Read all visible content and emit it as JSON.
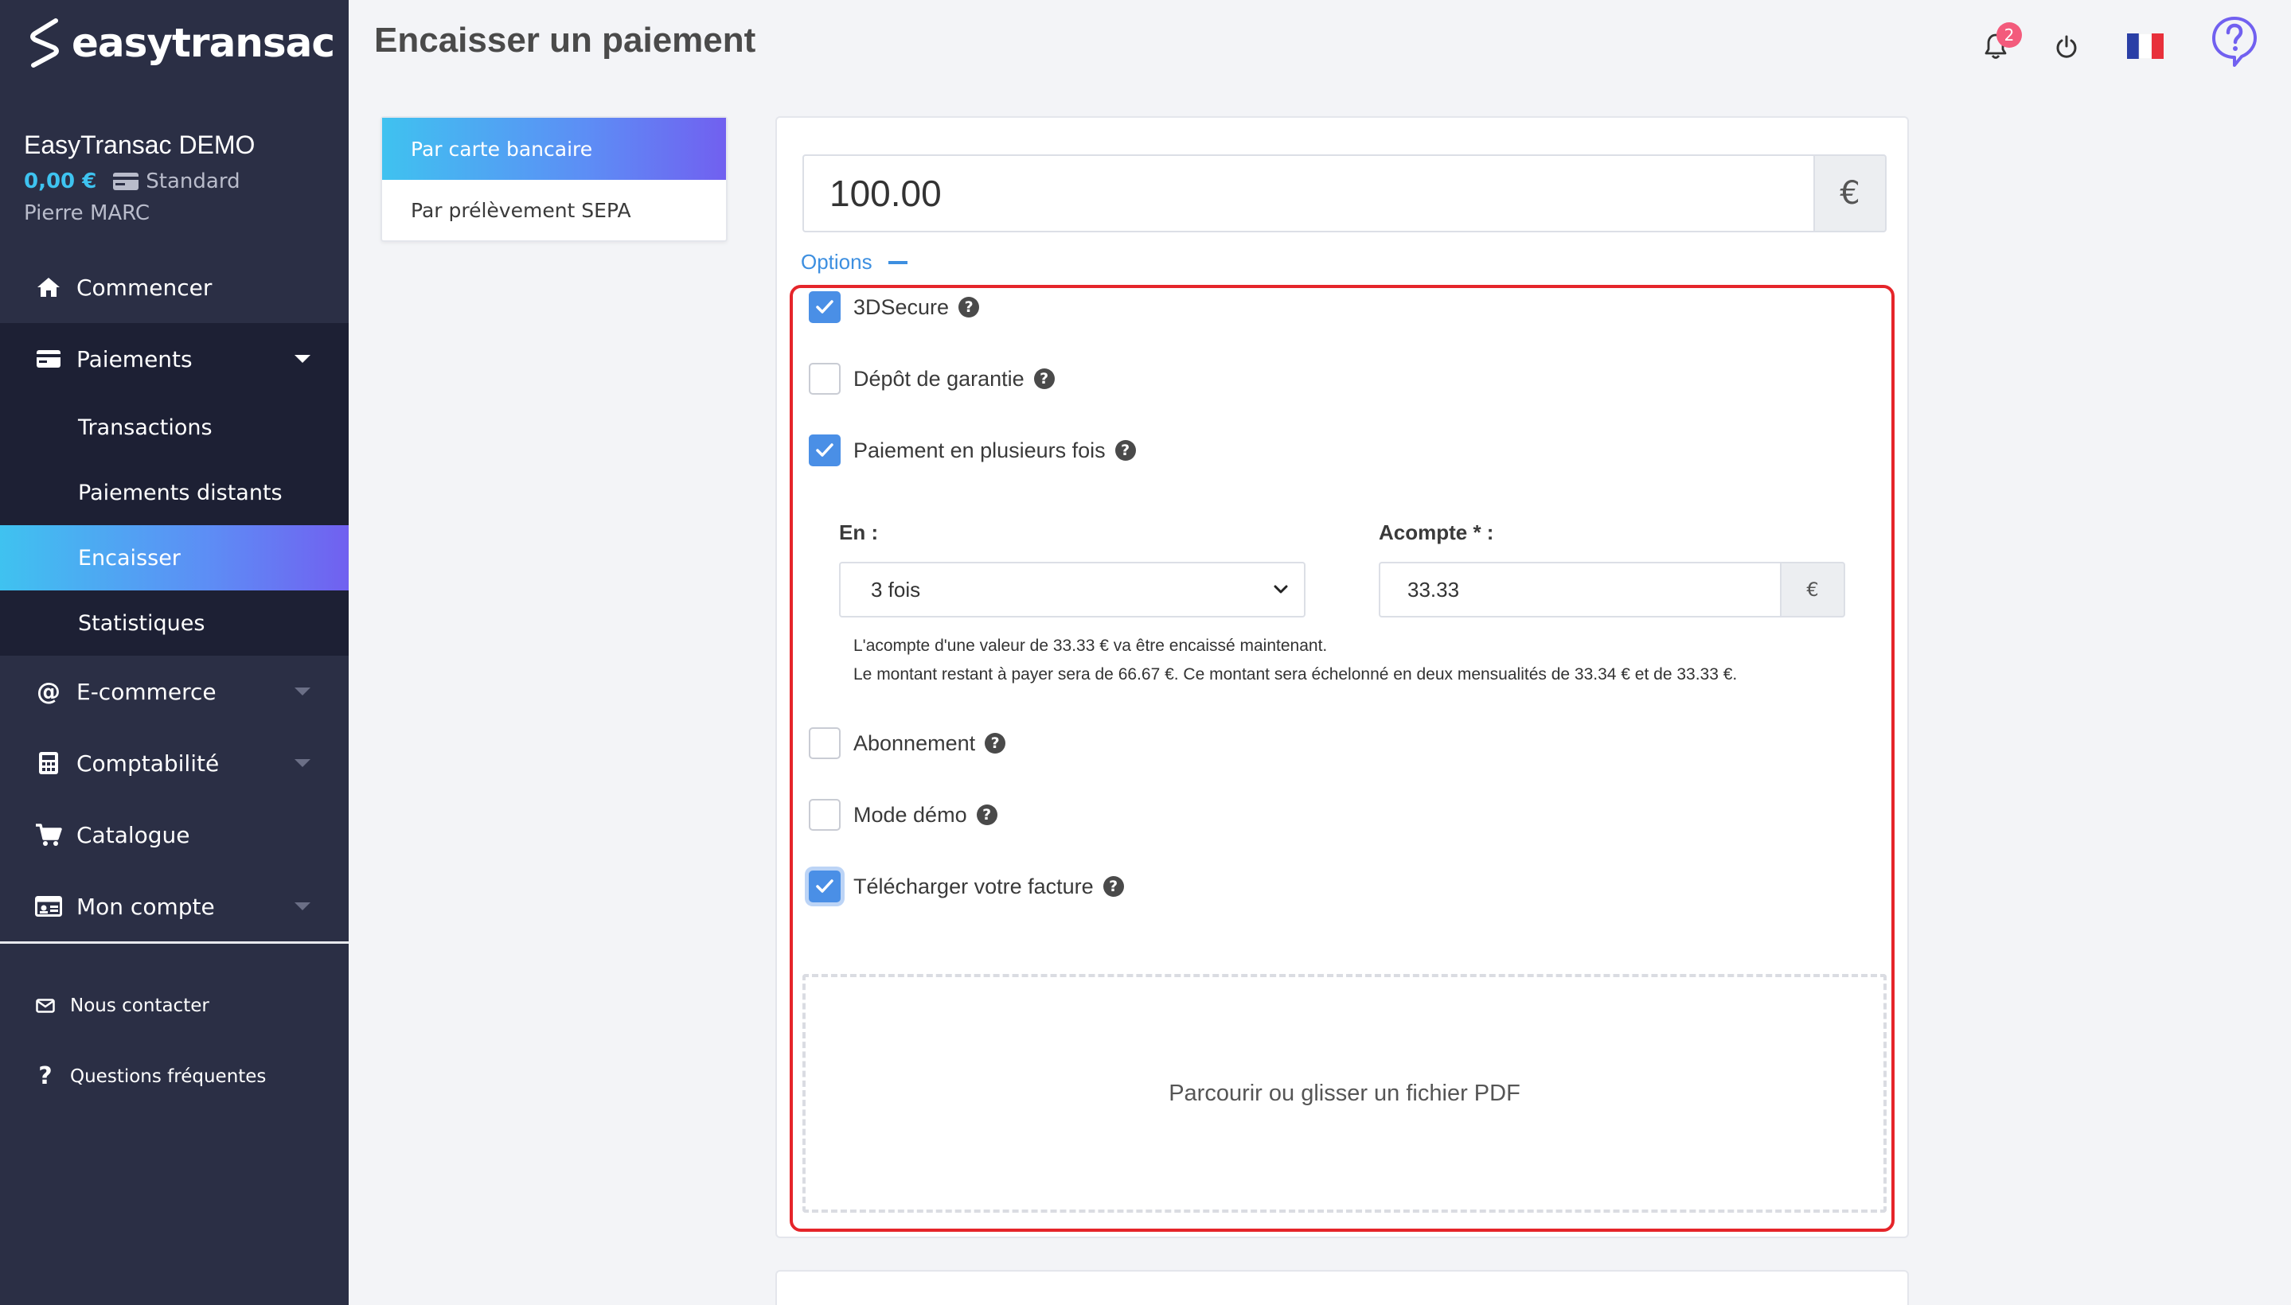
{
  "app": {
    "logo_text": "easytransac"
  },
  "account": {
    "name": "EasyTransac DEMO",
    "balance": "0,00 €",
    "plan": "Standard",
    "user": "Pierre MARC"
  },
  "sidebar": {
    "items": [
      {
        "label": "Commencer",
        "icon": "home-icon"
      },
      {
        "label": "Paiements",
        "icon": "credit-card-icon"
      },
      {
        "label": "E-commerce",
        "icon": "at-icon"
      },
      {
        "label": "Comptabilité",
        "icon": "calculator-icon"
      },
      {
        "label": "Catalogue",
        "icon": "cart-icon"
      },
      {
        "label": "Mon compte",
        "icon": "id-card-icon"
      }
    ],
    "payments_sub": [
      "Transactions",
      "Paiements distants",
      "Encaisser",
      "Statistiques"
    ],
    "footer": [
      {
        "label": "Nous contacter",
        "icon": "envelope-icon"
      },
      {
        "label": "Questions fréquentes",
        "icon": "question-icon"
      }
    ]
  },
  "header": {
    "title": "Encaisser un paiement",
    "notifications_count": "2",
    "accent_color": "#7160f0"
  },
  "payment_tabs": [
    "Par carte bancaire",
    "Par prélèvement SEPA"
  ],
  "form": {
    "amount": "100.00",
    "currency": "€",
    "options_label": "Options",
    "options": [
      {
        "label": "3DSecure",
        "checked": true
      },
      {
        "label": "Dépôt de garantie",
        "checked": false
      },
      {
        "label": "Paiement en plusieurs fois",
        "checked": true
      },
      {
        "label": "Abonnement",
        "checked": false
      },
      {
        "label": "Mode démo",
        "checked": false
      },
      {
        "label": "Télécharger votre facture",
        "checked": true
      }
    ],
    "installments": {
      "en_label": "En :",
      "en_value": "3 fois",
      "acompte_label": "Acompte * :",
      "acompte_value": "33.33",
      "acompte_currency": "€",
      "info_line1": "L'acompte d'une valeur de 33.33 € va être encaissé maintenant.",
      "info_line2": "Le montant restant à payer sera de 66.67 €. Ce montant sera échelonné en deux mensualités de 33.34 € et de 33.33 €."
    },
    "dropzone_text": "Parcourir ou glisser un fichier PDF"
  },
  "colors": {
    "sidebar_bg": "#2b2f45",
    "active_gradient_start": "#3fc2f0",
    "active_gradient_end": "#7160f0",
    "highlight_border": "#e5252a",
    "checkbox_checked": "#4a8fe6"
  }
}
